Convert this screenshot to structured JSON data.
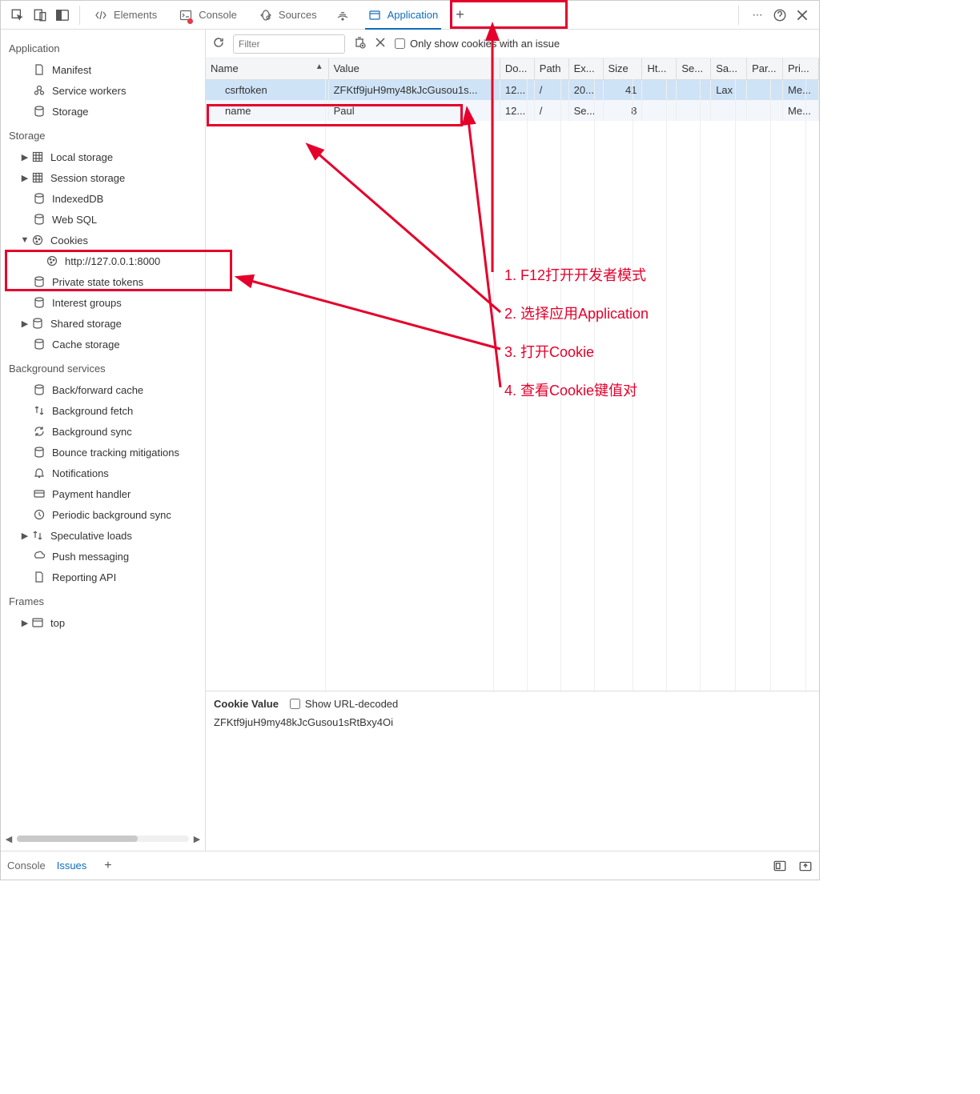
{
  "tabs": {
    "elements": "Elements",
    "console": "Console",
    "sources": "Sources",
    "application": "Application"
  },
  "sidebar": {
    "application": {
      "title": "Application",
      "items": [
        "Manifest",
        "Service workers",
        "Storage"
      ]
    },
    "storage": {
      "title": "Storage",
      "items": [
        "Local storage",
        "Session storage",
        "IndexedDB",
        "Web SQL",
        "Cookies",
        "Private state tokens",
        "Interest groups",
        "Shared storage",
        "Cache storage"
      ],
      "cookie_origin": "http://127.0.0.1:8000"
    },
    "background": {
      "title": "Background services",
      "items": [
        "Back/forward cache",
        "Background fetch",
        "Background sync",
        "Bounce tracking mitigations",
        "Notifications",
        "Payment handler",
        "Periodic background sync",
        "Speculative loads",
        "Push messaging",
        "Reporting API"
      ]
    },
    "frames": {
      "title": "Frames",
      "top": "top"
    }
  },
  "toolbar": {
    "filter_placeholder": "Filter",
    "issue_label": "Only show cookies with an issue"
  },
  "columns": [
    "Name",
    "Value",
    "Do...",
    "Path",
    "Ex...",
    "Size",
    "Ht...",
    "Se...",
    "Sa...",
    "Par...",
    "Pri..."
  ],
  "rows": [
    {
      "name": "csrftoken",
      "value": "ZFKtf9juH9my48kJcGusou1s...",
      "domain": "12...",
      "path": "/",
      "expires": "20...",
      "size": "41",
      "http": "",
      "secure": "",
      "same": "Lax",
      "part": "",
      "pri": "Me..."
    },
    {
      "name": "name",
      "value": "Paul",
      "domain": "12...",
      "path": "/",
      "expires": "Se...",
      "size": "8",
      "http": "",
      "secure": "",
      "same": "",
      "part": "",
      "pri": "Me..."
    }
  ],
  "detail": {
    "label": "Cookie Value",
    "decode_label": "Show URL-decoded",
    "value": "ZFKtf9juH9my48kJcGusou1sRtBxy4Oi"
  },
  "drawer": {
    "console": "Console",
    "issues": "Issues"
  },
  "annotations": {
    "step1": "1. F12打开开发者模式",
    "step2": "2. 选择应用Application",
    "step3": "3. 打开Cookie",
    "step4": "4. 查看Cookie键值对"
  }
}
